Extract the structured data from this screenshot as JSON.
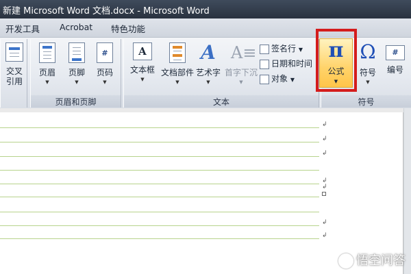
{
  "window": {
    "title": "新建 Microsoft Word 文档.docx - Microsoft Word"
  },
  "tabs": [
    "开发工具",
    "Acrobat",
    "特色功能"
  ],
  "groups": {
    "left_partial": {
      "button_line1": "交叉",
      "button_line2": "引用"
    },
    "header_footer": {
      "label": "页眉和页脚",
      "buttons": [
        "页眉",
        "页脚",
        "页码"
      ]
    },
    "text": {
      "label": "文本",
      "big_buttons": [
        "文本框",
        "文档部件",
        "艺术字",
        "首字下沉"
      ],
      "small_buttons": [
        "签名行",
        "日期和时间",
        "对象"
      ]
    },
    "symbols": {
      "label": "符号",
      "buttons": [
        "公式",
        "符号",
        "编号"
      ]
    }
  },
  "icons": {
    "formula": "π",
    "symbol": "Ω",
    "number": "#"
  },
  "watermark": {
    "text": "悟空问答"
  },
  "colors": {
    "highlight_border": "#d41c1c",
    "gridline": "#b7d38c",
    "accent": "#1f4fb6"
  }
}
